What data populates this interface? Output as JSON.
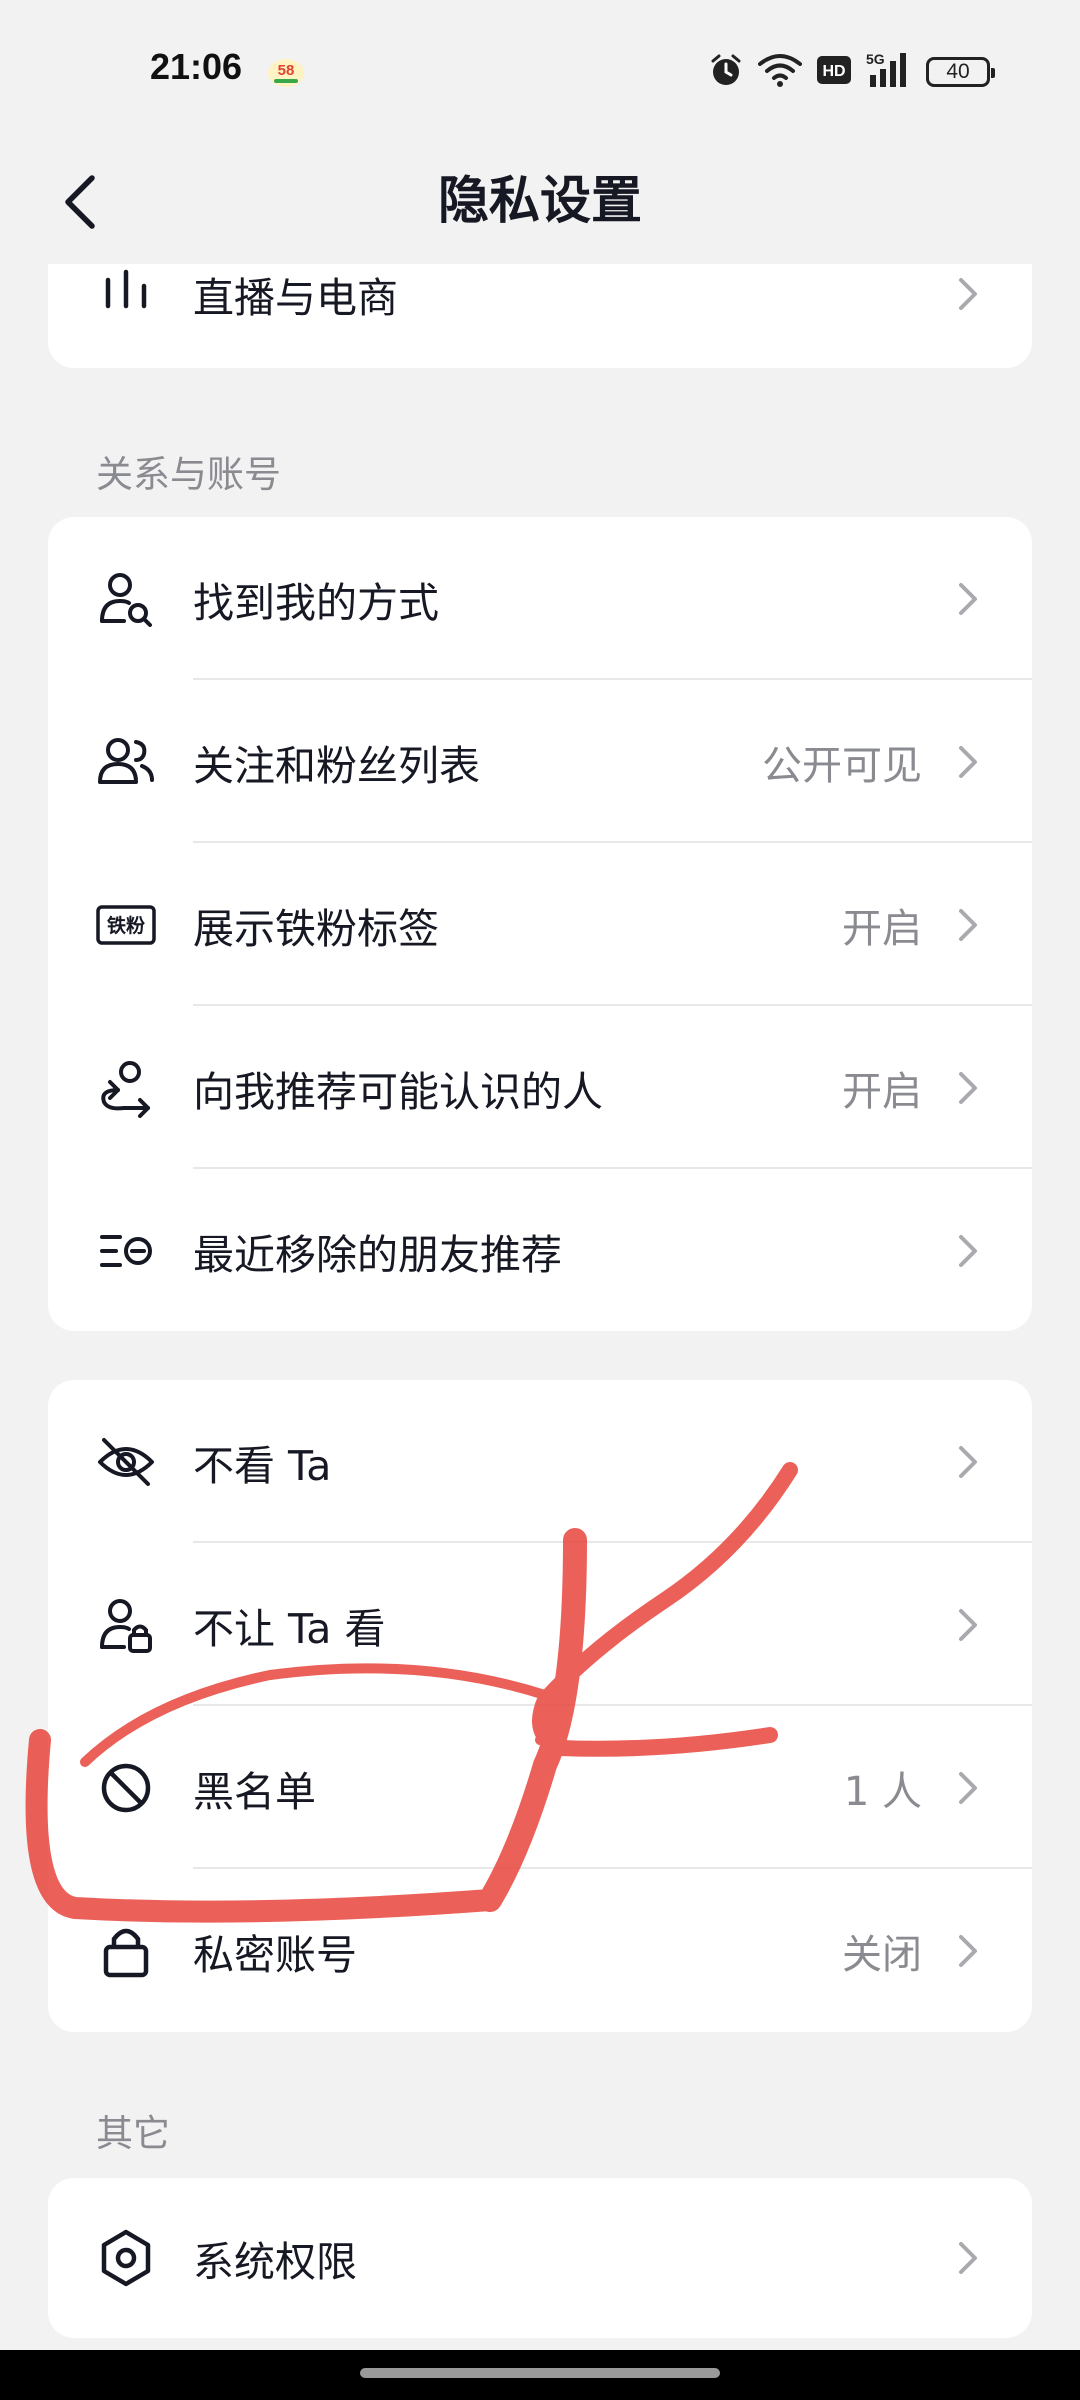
{
  "status_bar": {
    "time": "21:06",
    "badge_text": "58",
    "network": "5G",
    "hd": "HD",
    "battery": "40"
  },
  "nav": {
    "title": "隐私设置"
  },
  "top_card": {
    "items": [
      {
        "label": "直播与电商",
        "icon": "bar-chart-icon"
      }
    ]
  },
  "section_relations": {
    "title": "关系与账号",
    "items": [
      {
        "label": "找到我的方式",
        "value": "",
        "icon": "person-search-icon"
      },
      {
        "label": "关注和粉丝列表",
        "value": "公开可见",
        "icon": "people-icon"
      },
      {
        "label": "展示铁粉标签",
        "value": "开启",
        "icon": "iron-fan-badge-icon",
        "icon_text": "铁粉"
      },
      {
        "label": "向我推荐可能认识的人",
        "value": "开启",
        "icon": "person-recommend-icon"
      },
      {
        "label": "最近移除的朋友推荐",
        "value": "",
        "icon": "removed-list-icon"
      }
    ]
  },
  "section_block": {
    "items": [
      {
        "label": "不看 Ta",
        "value": "",
        "icon": "eye-off-icon"
      },
      {
        "label": "不让 Ta 看",
        "value": "",
        "icon": "person-lock-icon"
      },
      {
        "label": "黑名单",
        "value": "1 人",
        "icon": "block-icon"
      },
      {
        "label": "私密账号",
        "value": "关闭",
        "icon": "lock-icon"
      }
    ]
  },
  "section_other": {
    "title": "其它",
    "items": [
      {
        "label": "系统权限",
        "value": "",
        "icon": "hexagon-settings-icon"
      }
    ]
  },
  "colors": {
    "background": "#f2f2f3",
    "card": "#ffffff",
    "text_primary": "#161823",
    "text_secondary": "#8a8b91",
    "annotation": "#e8453c"
  }
}
